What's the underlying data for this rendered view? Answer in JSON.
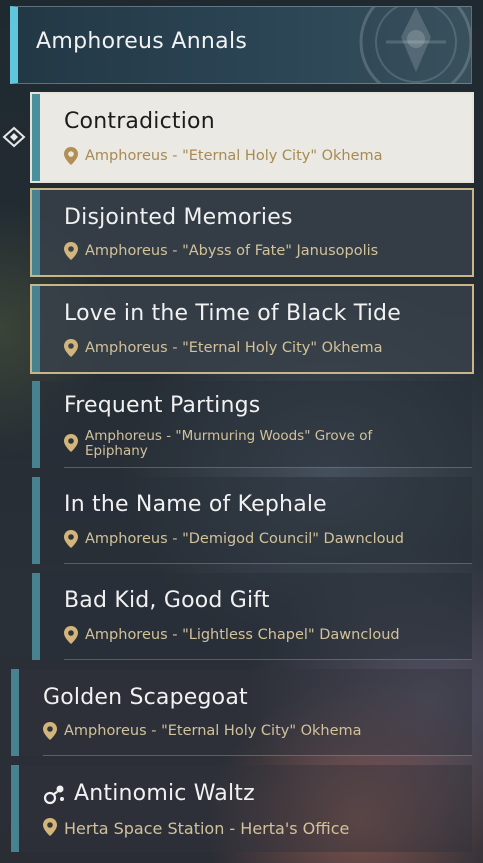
{
  "header": {
    "title": "Amphoreus Annals",
    "accent_color": "#5fc6dd"
  },
  "pointer_icon": "diamond-pointer-icon",
  "missions": [
    {
      "title": "Contradiction",
      "location": "Amphoreus - \"Eternal Holy City\" Okhema",
      "state": "selected",
      "icon": "map-pin-icon"
    },
    {
      "title": "Disjointed Memories",
      "location": "Amphoreus - \"Abyss of Fate\" Janusopolis",
      "state": "tracked",
      "icon": "map-pin-icon"
    },
    {
      "title": "Love in the Time of Black Tide",
      "location": "Amphoreus - \"Eternal Holy City\" Okhema",
      "state": "tracked",
      "icon": "map-pin-icon"
    },
    {
      "title": "Frequent Partings",
      "location": "Amphoreus - \"Murmuring Woods\" Grove of Epiphany",
      "state": "normal",
      "icon": "map-pin-icon"
    },
    {
      "title": "In the Name of Kephale",
      "location": "Amphoreus - \"Demigod Council\" Dawncloud",
      "state": "normal",
      "icon": "map-pin-icon"
    },
    {
      "title": "Bad Kid, Good Gift",
      "location": "Amphoreus - \"Lightless Chapel\" Dawncloud",
      "state": "normal",
      "icon": "map-pin-icon"
    },
    {
      "title": "Golden Scapegoat",
      "location": "Amphoreus - \"Eternal Holy City\" Okhema",
      "state": "normal",
      "icon": "map-pin-icon"
    },
    {
      "title": "Antinomic Waltz",
      "location": "Herta Space Station - Herta's Office",
      "state": "normal",
      "icon": "map-pin-icon",
      "title_icon": "molecule-icon"
    }
  ],
  "colors": {
    "location_text": "#d2c29a",
    "selected_bg": "#ebe9e4",
    "tracked_border": "#c9b58a",
    "side_bar": "#46828f"
  }
}
